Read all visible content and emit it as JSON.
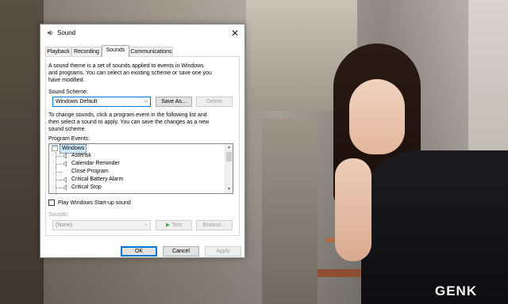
{
  "watermark": "GENK",
  "dialog": {
    "title": "Sound",
    "close_glyph": "✕",
    "tabs": [
      "Playback",
      "Recording",
      "Sounds",
      "Communications"
    ],
    "active_tab": "Sounds",
    "theme_description": [
      "A sound theme is a set of sounds applied to events in Windows",
      "and programs.  You can select an existing scheme or save one you",
      "have modified."
    ],
    "scheme_label": "Sound Scheme:",
    "scheme_value": "Windows Default",
    "save_as_label": "Save As...",
    "delete_label": "Delete",
    "change_description": [
      "To change sounds, click a program event in the following list and",
      "then select a sound to apply.  You can save the changes as a new",
      "sound scheme."
    ],
    "program_events_label": "Program Events:",
    "events": [
      {
        "label": "Windows",
        "icon": "app-icon",
        "selected": true
      },
      {
        "label": "Asterisk",
        "icon": "speaker-icon"
      },
      {
        "label": "Calendar Reminder",
        "icon": "speaker-icon"
      },
      {
        "label": "Close Program",
        "icon": ""
      },
      {
        "label": "Critical Battery Alarm",
        "icon": "speaker-icon"
      },
      {
        "label": "Critical Stop",
        "icon": "speaker-icon"
      }
    ],
    "startup_checkbox_label": "Play Windows Start-up sound",
    "startup_checked": false,
    "sounds_label": "Sounds:",
    "sounds_value": "(None)",
    "test_label": "Test",
    "browse_label": "Browse...",
    "ok_label": "OK",
    "cancel_label": "Cancel",
    "apply_label": "Apply"
  },
  "colors": {
    "accent": "#0078d7",
    "selection": "#cce8ff",
    "test_play": "#4caf50"
  }
}
